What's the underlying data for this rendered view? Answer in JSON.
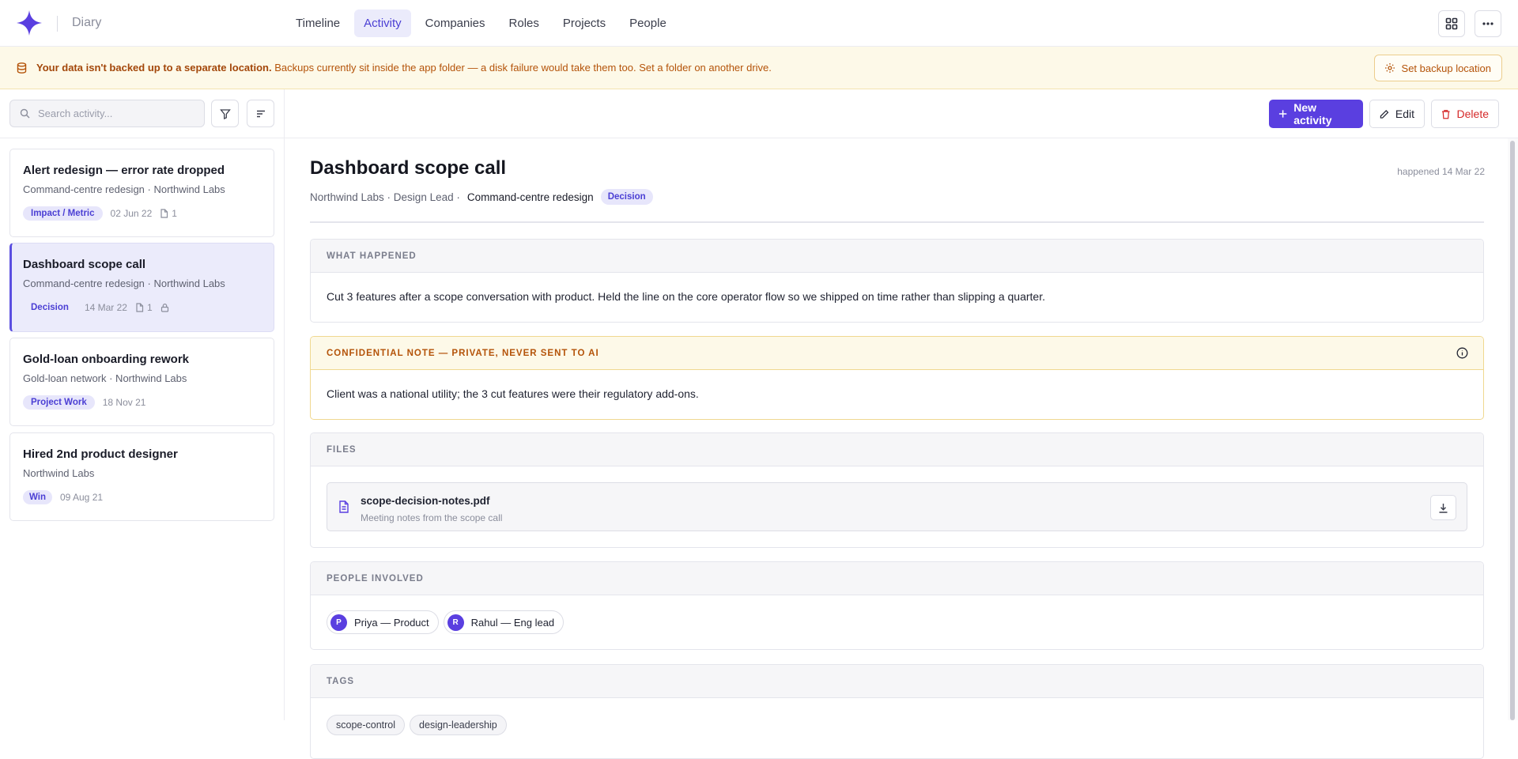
{
  "app": {
    "title": "Diary"
  },
  "nav": {
    "tabs": [
      "Timeline",
      "Activity",
      "Companies",
      "Roles",
      "Projects",
      "People"
    ],
    "active": "Activity"
  },
  "header_icons": [
    "layout-grid-icon",
    "more-horizontal-icon"
  ],
  "banner": {
    "bold": "Your data isn't backed up to a separate location.",
    "text": " Backups currently sit inside the app folder — a disk failure would take them too. Set a folder on another drive.",
    "button": "Set backup location"
  },
  "sidebar": {
    "search_placeholder": "Search activity...",
    "items": [
      {
        "title": "Alert redesign — error rate dropped",
        "subtitle": "Command-centre redesign · Northwind Labs",
        "tag": "Impact / Metric",
        "date": "02 Jun 22",
        "files": "1",
        "locked": false
      },
      {
        "title": "Dashboard scope call",
        "subtitle": "Command-centre redesign · Northwind Labs",
        "tag": "Decision",
        "date": "14 Mar 22",
        "files": "1",
        "locked": true
      },
      {
        "title": "Gold-loan onboarding rework",
        "subtitle": "Gold-loan network · Northwind Labs",
        "tag": "Project Work",
        "date": "18 Nov 21",
        "files": "",
        "locked": false
      },
      {
        "title": "Hired 2nd product designer",
        "subtitle": "Northwind Labs",
        "tag": "Win",
        "date": "09 Aug 21",
        "files": "",
        "locked": false
      }
    ]
  },
  "toolbar": {
    "new_label": "New activity",
    "edit_label": "Edit",
    "delete_label": "Delete"
  },
  "detail": {
    "title": "Dashboard scope call",
    "meta": "Northwind Labs · Design Lead ·",
    "project": "Command-centre redesign",
    "type": "Decision",
    "happened": "happened 14 Mar 22",
    "what_happened_label": "WHAT HAPPENED",
    "what_happened": "Cut 3 features after a scope conversation with product. Held the line on the core operator flow so we shipped on time rather than slipping a quarter.",
    "confidential_label": "CONFIDENTIAL NOTE — PRIVATE, NEVER SENT TO AI",
    "confidential": "Client was a national utility; the 3 cut features were their regulatory add-ons.",
    "files_label": "FILES",
    "file": {
      "name": "scope-decision-notes.pdf",
      "desc": "Meeting notes from the scope call"
    },
    "people_label": "PEOPLE INVOLVED",
    "people": [
      {
        "initial": "P",
        "name": "Priya — Product"
      },
      {
        "initial": "R",
        "name": "Rahul — Eng lead"
      }
    ],
    "tags_label": "TAGS",
    "tags": [
      "scope-control",
      "design-leadership"
    ]
  },
  "colors": {
    "accent": "#5a3fe0",
    "accent_soft": "#ebebfb",
    "warning_bg": "#fdf9e8",
    "warning_text": "#b45309",
    "danger": "#d52a2a"
  }
}
